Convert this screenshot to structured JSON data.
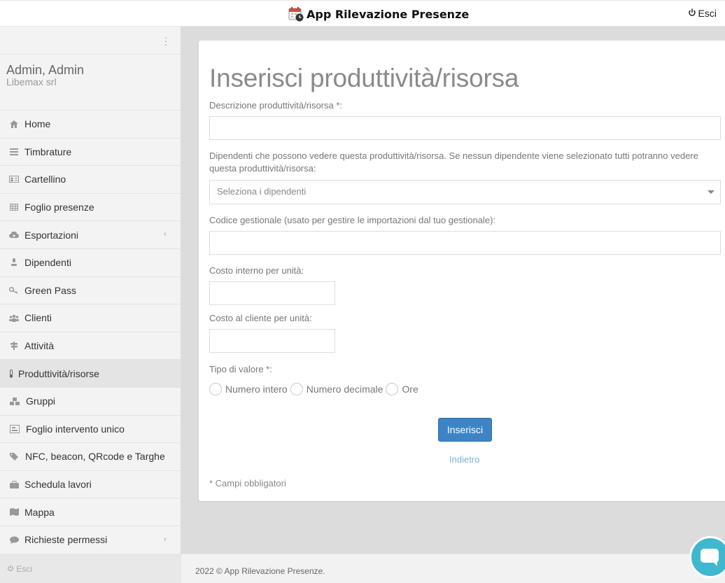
{
  "header": {
    "title": "App Rilevazione Presenze",
    "logout_label": "Esci"
  },
  "sidebar": {
    "user_name": "Admin, Admin",
    "company": "Libemax srl",
    "items": [
      {
        "label": "Home",
        "icon": "home-icon"
      },
      {
        "label": "Timbrature",
        "icon": "list-icon"
      },
      {
        "label": "Cartellino",
        "icon": "id-card-icon"
      },
      {
        "label": "Foglio presenze",
        "icon": "table-icon"
      },
      {
        "label": "Esportazioni",
        "icon": "cloud-download-icon"
      },
      {
        "label": "Dipendenti",
        "icon": "user-icon"
      },
      {
        "label": "Green Pass",
        "icon": "key-icon"
      },
      {
        "label": "Clienti",
        "icon": "users-icon"
      },
      {
        "label": "Attività",
        "icon": "signpost-icon"
      },
      {
        "label": "Produttività/risorse",
        "icon": "thermometer-icon"
      },
      {
        "label": "Gruppi",
        "icon": "cubes-icon"
      },
      {
        "label": "Foglio intervento unico",
        "icon": "form-icon"
      },
      {
        "label": "NFC, beacon, QRcode e Targhe",
        "icon": "tags-icon"
      },
      {
        "label": "Schedula lavori",
        "icon": "briefcase-icon"
      },
      {
        "label": "Mappa",
        "icon": "map-icon"
      },
      {
        "label": "Richieste permessi",
        "icon": "comment-icon"
      }
    ],
    "footer_logout": "Esci"
  },
  "form": {
    "title": "Inserisci produttività/risorsa",
    "description_label": "Descrizione produttività/risorsa *:",
    "description_value": "",
    "employees_label": "Dipendenti che possono vedere questa produttività/risorsa. Se nessun dipendente viene selezionato tutti potranno vedere questa produttività/risorsa:",
    "employees_placeholder": "Seleziona i dipendenti",
    "code_label": "Codice gestionale (usato per gestire le importazioni dal tuo gestionale):",
    "code_value": "",
    "internal_cost_label": "Costo interno per unità:",
    "internal_cost_value": "",
    "client_cost_label": "Costo al cliente per unità:",
    "client_cost_value": "",
    "value_type_label": "Tipo di valore *:",
    "value_type_options": [
      "Numero intero",
      "Numero decimale",
      "Ore"
    ],
    "submit_label": "Inserisci",
    "back_label": "Indietro",
    "required_note": "* Campi obbligatori"
  },
  "footer": {
    "copyright": "2022 © App Rilevazione Presenze."
  },
  "colors": {
    "primary_button": "#3c84c6",
    "link": "#7db1d8",
    "chat_bubble": "#3fb8cf"
  }
}
